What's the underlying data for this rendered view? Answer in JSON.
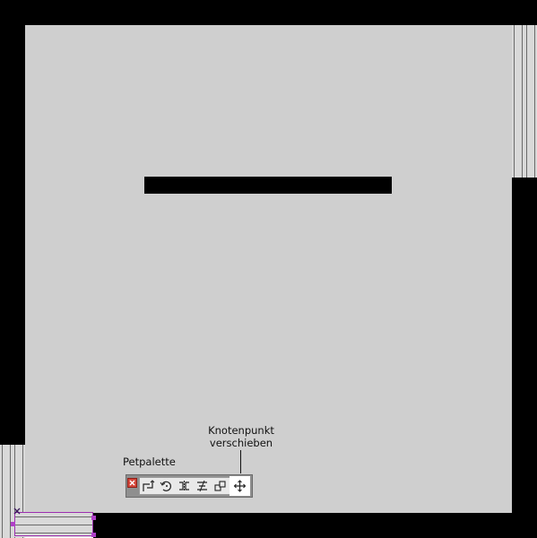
{
  "labels": {
    "pet_palette": "Petpalette",
    "move_node_line1": "Knotenpunkt",
    "move_node_line2": "verschieben"
  },
  "pet_palette": {
    "buttons": [
      {
        "icon": "close-icon"
      },
      {
        "icon": "offset-edge-icon"
      },
      {
        "icon": "rotate-icon"
      },
      {
        "icon": "mirror-icon"
      },
      {
        "icon": "align-icon"
      },
      {
        "icon": "copy-move-icon"
      },
      {
        "icon": "move-node-icon",
        "active": true
      }
    ]
  },
  "colors": {
    "wall": "#000000",
    "floor": "#cfcfcf",
    "selection": "#9d2fb0",
    "palette_bg": "#8f8f8f",
    "palette_active": "#ffffff"
  }
}
